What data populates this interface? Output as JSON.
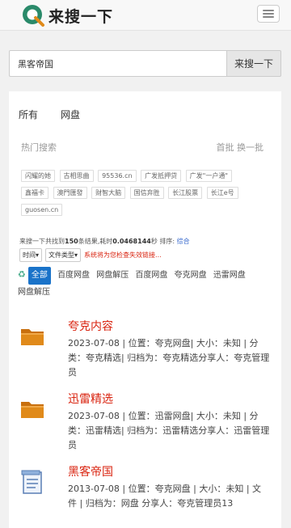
{
  "brand": {
    "name": "来搜一下"
  },
  "search": {
    "value": "黑客帝国",
    "button": "来搜一下"
  },
  "tabs": [
    {
      "label": "所有"
    },
    {
      "label": "网盘"
    }
  ],
  "hot": {
    "title": "热门搜索",
    "actions": "首批 换一批",
    "tags": [
      "闪耀的她",
      "古相思曲",
      "95536.cn",
      "广发抵押贷",
      "广发\"一户通\"",
      "鑫福卡",
      "澳門匯發",
      "财智大脑",
      "国信弃胜",
      "长江股票",
      "长江e号",
      "guosen.cn"
    ]
  },
  "stats": {
    "prefix": "来搜一下共找到",
    "count": "150",
    "middle": "条结果,耗时",
    "time": "0.0468144",
    "suffix": "秒 排序:",
    "sort": "综合"
  },
  "filters": {
    "time": "时间",
    "filetype": "文件类型",
    "warning": "系统将为您检查失效链接..."
  },
  "types": [
    "全部",
    "百度网盘",
    "网盘解压",
    "百度网盘",
    "夸克网盘",
    "迅雷网盘",
    "网盘解压"
  ],
  "results": [
    {
      "title": "夸克内容",
      "icon": "folder-icon",
      "meta": "2023-07-08 | 位置：夸克网盘| 大小：未知 | 分类：夸克精选| 归档为：夸克精选分享人：夸克管理员"
    },
    {
      "title": "迅雷精选",
      "icon": "folder-icon",
      "meta": "2023-07-08 | 位置：迅雷网盘| 大小：未知 | 分类：迅雷精选| 归档为：迅雷精选分享人：迅雷管理员"
    },
    {
      "title": "黑客帝国",
      "icon": "document-icon",
      "meta": "2013-07-08 | 位置：夸克网盘 | 大小：未知 | 文件 | 归档为：网盘 分享人：夸克管理员13"
    }
  ],
  "colors": {
    "accent": "#d9230f",
    "link": "#3366cc",
    "folder": "#e08a1a",
    "logo": "#2a8a6a"
  }
}
